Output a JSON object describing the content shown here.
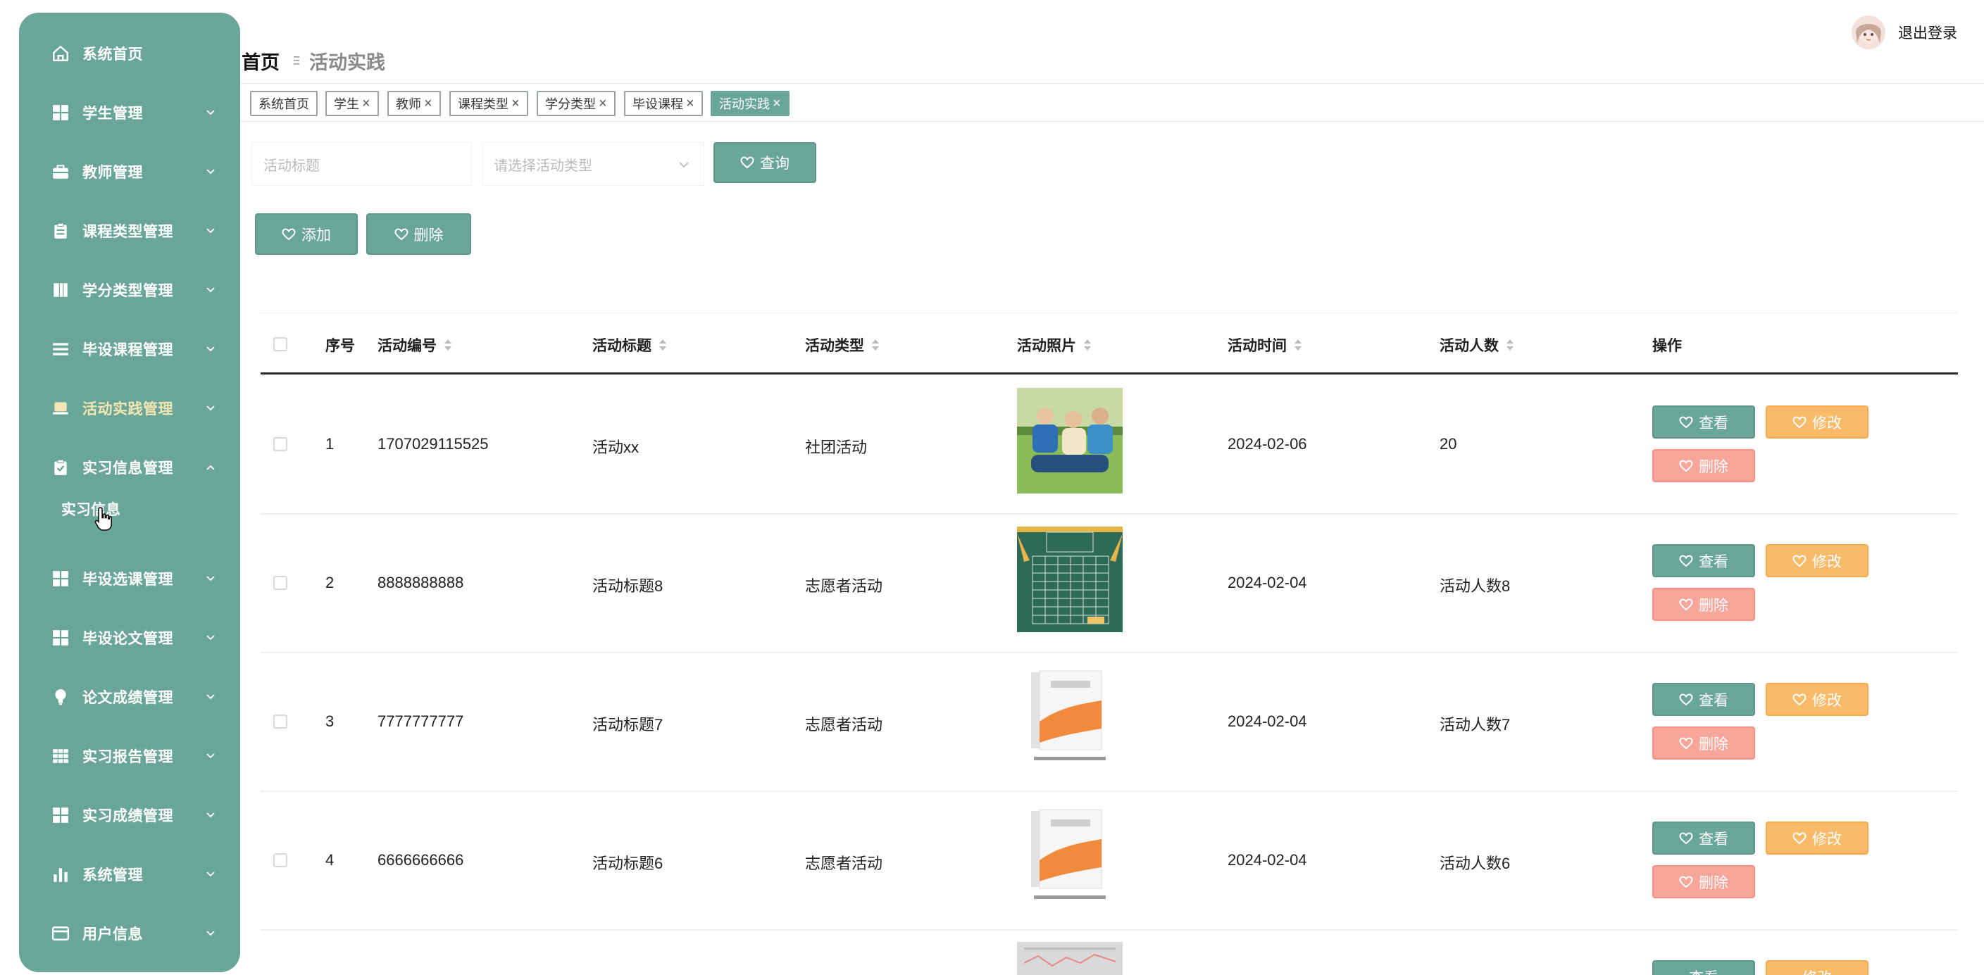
{
  "sidebar": {
    "items": [
      {
        "label": "系统首页",
        "icon": "home-icon"
      },
      {
        "label": "学生管理",
        "icon": "grid-icon"
      },
      {
        "label": "教师管理",
        "icon": "briefcase-icon"
      },
      {
        "label": "课程类型管理",
        "icon": "clipboard-icon"
      },
      {
        "label": "学分类型管理",
        "icon": "book-icon"
      },
      {
        "label": "毕设课程管理",
        "icon": "list-icon"
      },
      {
        "label": "活动实践管理",
        "icon": "laptop-icon"
      },
      {
        "label": "实习信息管理",
        "icon": "clipboard-check-icon"
      },
      {
        "label": "毕设选课管理",
        "icon": "grid-icon"
      },
      {
        "label": "毕设论文管理",
        "icon": "grid-icon"
      },
      {
        "label": "论文成绩管理",
        "icon": "bulb-icon"
      },
      {
        "label": "实习报告管理",
        "icon": "table-icon"
      },
      {
        "label": "实习成绩管理",
        "icon": "grid-icon"
      },
      {
        "label": "系统管理",
        "icon": "bar-chart-icon"
      },
      {
        "label": "用户信息",
        "icon": "card-icon"
      }
    ],
    "expanded_sub": {
      "label": "实习信息"
    }
  },
  "header": {
    "breadcrumb_home": "首页",
    "breadcrumb_current": "活动实践",
    "logout": "退出登录"
  },
  "tags": [
    {
      "label": "系统首页",
      "closable": false
    },
    {
      "label": "学生",
      "closable": true
    },
    {
      "label": "教师",
      "closable": true
    },
    {
      "label": "课程类型",
      "closable": true
    },
    {
      "label": "学分类型",
      "closable": true
    },
    {
      "label": "毕设课程",
      "closable": true
    },
    {
      "label": "活动实践",
      "closable": true,
      "active": true
    }
  ],
  "tag_close_glyph": "×",
  "search": {
    "title_placeholder": "活动标题",
    "type_placeholder": "请选择活动类型",
    "query_label": "查询"
  },
  "toolbar": {
    "add_label": "添加",
    "delete_label": "删除"
  },
  "table": {
    "headers": {
      "index": "序号",
      "code": "活动编号",
      "title": "活动标题",
      "type": "活动类型",
      "photo": "活动照片",
      "time": "活动时间",
      "count": "活动人数",
      "ops": "操作"
    },
    "rows": [
      {
        "index": "1",
        "code": "1707029115525",
        "title": "活动xx",
        "type": "社团活动",
        "photo": "students-photo",
        "time": "2024-02-06",
        "count": "20"
      },
      {
        "index": "2",
        "code": "8888888888",
        "title": "活动标题8",
        "type": "志愿者活动",
        "photo": "blackboard-photo",
        "time": "2024-02-04",
        "count": "活动人数8"
      },
      {
        "index": "3",
        "code": "7777777777",
        "title": "活动标题7",
        "type": "志愿者活动",
        "photo": "book-cover-photo",
        "time": "2024-02-04",
        "count": "活动人数7"
      },
      {
        "index": "4",
        "code": "6666666666",
        "title": "活动标题6",
        "type": "志愿者活动",
        "photo": "book-cover-photo",
        "time": "2024-02-04",
        "count": "活动人数6"
      }
    ],
    "row_actions": {
      "view": "查看",
      "edit": "修改",
      "delete": "删除"
    }
  },
  "colors": {
    "accent": "#6aa697",
    "edit": "#f9bb6a",
    "danger": "#f8a59a"
  }
}
